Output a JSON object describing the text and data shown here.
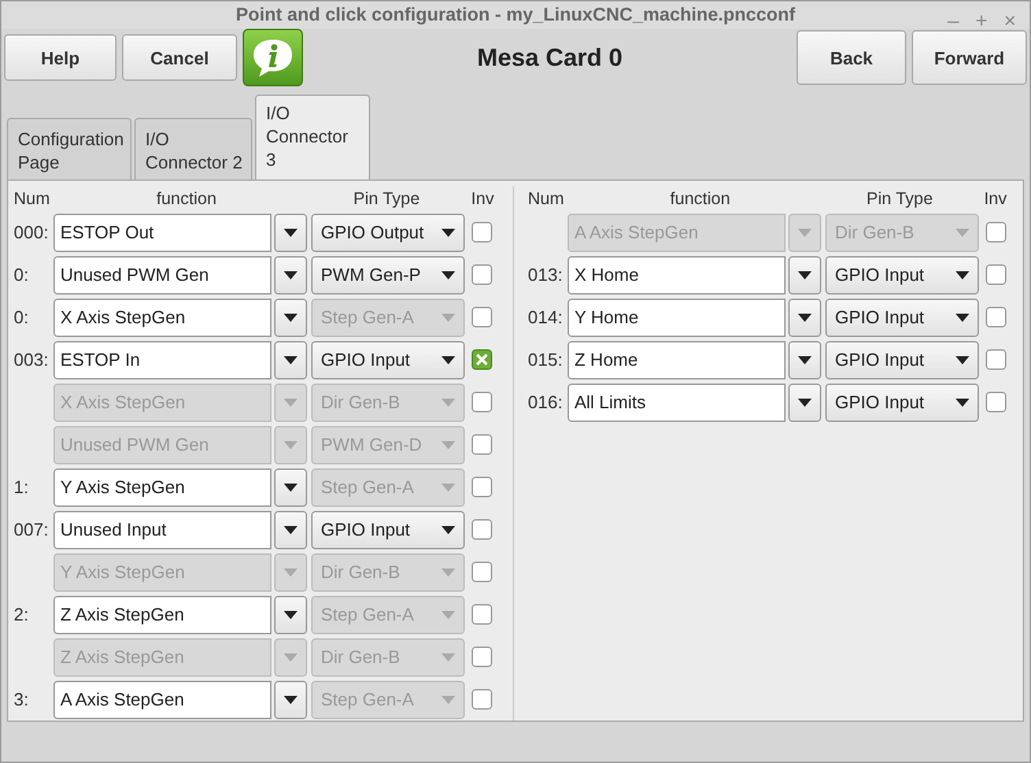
{
  "window": {
    "title": "Point and click configuration - my_LinuxCNC_machine.pncconf",
    "controls": [
      "–",
      "+",
      "×"
    ]
  },
  "toolbar": {
    "left_buttons": [
      "Help",
      "Cancel"
    ],
    "heading": "Mesa Card 0",
    "right_buttons": [
      "Back",
      "Forward"
    ]
  },
  "tabs": [
    {
      "label": "Configuration Page",
      "selected": false
    },
    {
      "label": "I/O Connector 2",
      "selected": false
    },
    {
      "label": "I/O Connector 3",
      "selected": true
    }
  ],
  "panels": [
    {
      "columns": [
        "Num",
        "function",
        "Pin Type",
        "Inv"
      ],
      "rows": [
        {
          "num": "000:",
          "function": "ESTOP Out",
          "function_disabled": false,
          "pin_type": "GPIO Output",
          "pin_type_disabled": false,
          "inverted": false
        },
        {
          "num": "0:",
          "function": "Unused PWM Gen",
          "function_disabled": false,
          "pin_type": "PWM Gen-P",
          "pin_type_disabled": false,
          "inverted": false
        },
        {
          "num": "0:",
          "function": "X Axis StepGen",
          "function_disabled": false,
          "pin_type": "Step Gen-A",
          "pin_type_disabled": true,
          "inverted": false
        },
        {
          "num": "003:",
          "function": "ESTOP In",
          "function_disabled": false,
          "pin_type": "GPIO Input",
          "pin_type_disabled": false,
          "inverted": true
        },
        {
          "function": "X Axis StepGen",
          "function_disabled": true,
          "pin_type": "Dir Gen-B",
          "pin_type_disabled": true,
          "inverted": false
        },
        {
          "function": "Unused PWM Gen",
          "function_disabled": true,
          "pin_type": "PWM Gen-D",
          "pin_type_disabled": true,
          "inverted": false
        },
        {
          "num": "1:",
          "function": "Y Axis StepGen",
          "function_disabled": false,
          "pin_type": "Step Gen-A",
          "pin_type_disabled": true,
          "inverted": false
        },
        {
          "num": "007:",
          "function": "Unused Input",
          "function_disabled": false,
          "pin_type": "GPIO Input",
          "pin_type_disabled": false,
          "inverted": false
        },
        {
          "function": "Y Axis StepGen",
          "function_disabled": true,
          "pin_type": "Dir Gen-B",
          "pin_type_disabled": true,
          "inverted": false
        },
        {
          "num": "2:",
          "function": "Z Axis StepGen",
          "function_disabled": false,
          "pin_type": "Step Gen-A",
          "pin_type_disabled": true,
          "inverted": false
        },
        {
          "function": "Z Axis StepGen",
          "function_disabled": true,
          "pin_type": "Dir Gen-B",
          "pin_type_disabled": true,
          "inverted": false
        },
        {
          "num": "3:",
          "function": "A Axis StepGen",
          "function_disabled": false,
          "pin_type": "Step Gen-A",
          "pin_type_disabled": true,
          "inverted": false
        }
      ]
    },
    {
      "columns": [
        "Num",
        "function",
        "Pin Type",
        "Inv"
      ],
      "rows": [
        {
          "function": "A Axis StepGen",
          "function_disabled": true,
          "pin_type": "Dir Gen-B",
          "pin_type_disabled": true,
          "inverted": false
        },
        {
          "num": "013:",
          "function": "X Home",
          "function_disabled": false,
          "pin_type": "GPIO Input",
          "pin_type_disabled": false,
          "inverted": false
        },
        {
          "num": "014:",
          "function": "Y Home",
          "function_disabled": false,
          "pin_type": "GPIO Input",
          "pin_type_disabled": false,
          "inverted": false
        },
        {
          "num": "015:",
          "function": "Z Home",
          "function_disabled": false,
          "pin_type": "GPIO Input",
          "pin_type_disabled": false,
          "inverted": false
        },
        {
          "num": "016:",
          "function": "All Limits",
          "function_disabled": false,
          "pin_type": "GPIO Input",
          "pin_type_disabled": false,
          "inverted": false
        }
      ]
    }
  ]
}
